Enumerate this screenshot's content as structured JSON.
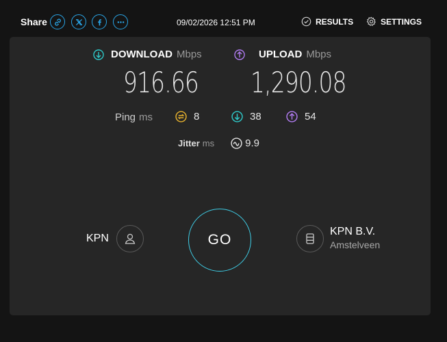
{
  "header": {
    "share_label": "Share",
    "share_buttons": [
      {
        "icon": "link-icon"
      },
      {
        "icon": "x-icon"
      },
      {
        "icon": "facebook-icon"
      },
      {
        "icon": "more-icon"
      }
    ],
    "datetime": "09/02/2026 12:51 PM",
    "results_label": "RESULTS",
    "settings_label": "SETTINGS"
  },
  "download": {
    "label": "DOWNLOAD",
    "unit": "Mbps",
    "value": "916.66",
    "color": "#2ec9c9"
  },
  "upload": {
    "label": "UPLOAD",
    "unit": "Mbps",
    "value": "1,290.08",
    "color": "#b07bf0"
  },
  "ping": {
    "label": "Ping",
    "unit": "ms",
    "idle": "8",
    "download": "38",
    "upload": "54",
    "idle_color": "#e6b12e"
  },
  "jitter": {
    "label": "Jitter",
    "unit": "ms",
    "value": "9.9"
  },
  "go_label": "GO",
  "isp": {
    "name": "KPN",
    "icon": "user-icon"
  },
  "server": {
    "name": "KPN B.V.",
    "location": "Amstelveen",
    "icon": "server-icon"
  },
  "colors": {
    "accent": "#2aa6e8",
    "go_ring": "#3fcfe8"
  }
}
